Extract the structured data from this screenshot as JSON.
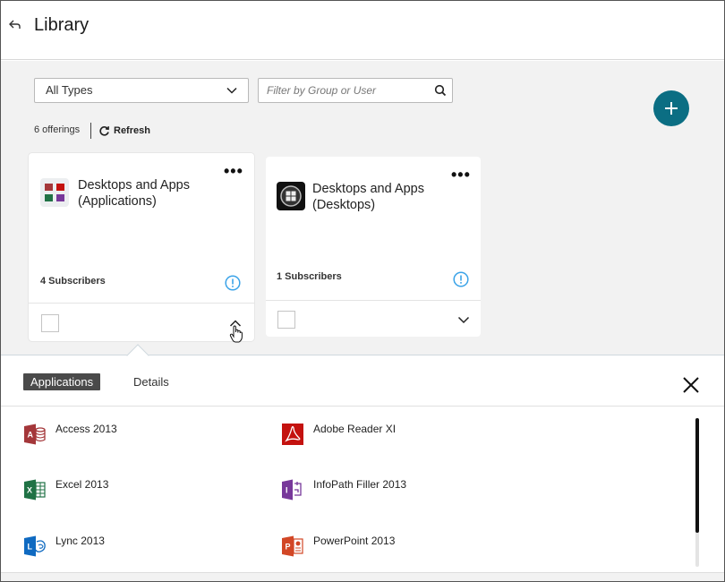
{
  "header": {
    "back_icon": "back-arrow-icon",
    "title": "Library"
  },
  "toolbar": {
    "type_select": {
      "value": "All Types",
      "icon": "chevron-down-icon"
    },
    "filter": {
      "placeholder": "Filter by Group or User",
      "value": "",
      "icon": "search-icon"
    },
    "add_icon": "plus-icon",
    "count_label": "6 offerings",
    "refresh_label": "Refresh",
    "refresh_icon": "refresh-icon"
  },
  "cards": [
    {
      "title_line1": "Desktops and Apps",
      "title_line2": "(Applications)",
      "icon": "applications-icon",
      "subscribers": "4 Subscribers",
      "expanded": true,
      "selected": false
    },
    {
      "title_line1": "Desktops and Apps",
      "title_line2": "(Desktops)",
      "icon": "desktop-icon",
      "subscribers": "1 Subscribers",
      "expanded": false,
      "selected": false
    }
  ],
  "panel": {
    "tabs": [
      {
        "label": "Applications",
        "active": true
      },
      {
        "label": "Details",
        "active": false
      }
    ],
    "apps": [
      {
        "name": "Access 2013",
        "icon": "access-icon",
        "color": "#a4373a"
      },
      {
        "name": "Adobe Reader XI",
        "icon": "adobe-reader-icon",
        "color": "#c4120f"
      },
      {
        "name": "Excel 2013",
        "icon": "excel-icon",
        "color": "#207245"
      },
      {
        "name": "InfoPath Filler 2013",
        "icon": "infopath-icon",
        "color": "#77389a"
      },
      {
        "name": "Lync 2013",
        "icon": "lync-icon",
        "color": "#0f6ac1"
      },
      {
        "name": "PowerPoint 2013",
        "icon": "powerpoint-icon",
        "color": "#d24726"
      }
    ]
  },
  "colors": {
    "accent": "#0b6e83",
    "info": "#3ba3e8",
    "active_tab": "#4a4a4a"
  }
}
